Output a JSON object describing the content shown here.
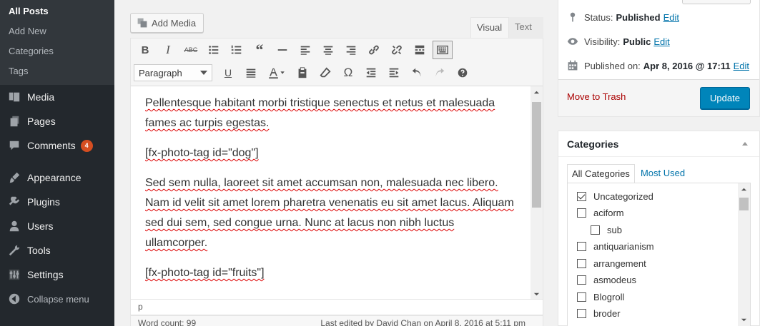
{
  "sidebar": {
    "submenu": [
      "All Posts",
      "Add New",
      "Categories",
      "Tags"
    ],
    "menu": [
      {
        "label": "Media",
        "icon": "media-icon"
      },
      {
        "label": "Pages",
        "icon": "pages-icon"
      },
      {
        "label": "Comments",
        "icon": "comments-icon",
        "badge": "4"
      },
      {
        "label": "Appearance",
        "icon": "appearance-icon"
      },
      {
        "label": "Plugins",
        "icon": "plugins-icon"
      },
      {
        "label": "Users",
        "icon": "users-icon"
      },
      {
        "label": "Tools",
        "icon": "tools-icon"
      },
      {
        "label": "Settings",
        "icon": "settings-icon"
      }
    ],
    "collapse_label": "Collapse menu"
  },
  "editor": {
    "add_media_label": "Add Media",
    "tabs": {
      "visual": "Visual",
      "text": "Text"
    },
    "format_select": "Paragraph",
    "paragraphs": [
      "Pellentesque habitant morbi tristique senectus et netus et malesuada fames ac turpis egestas.",
      "[fx-photo-tag id=\"dog\"]",
      "Sed sem nulla, laoreet sit amet accumsan non, malesuada nec libero. Nam id velit sit amet lorem pharetra venenatis eu sit amet lacus. Aliquam sed dui sem, sed congue urna. Nunc at lacus non nibh luctus ullamcorper.",
      "[fx-photo-tag id=\"fruits\"]"
    ],
    "path": "p",
    "word_count": "Word count: 99",
    "last_edited": "Last edited by David Chan on April 8, 2016 at 5:11 pm"
  },
  "publish": {
    "status_label": "Status:",
    "status_value": "Published",
    "visibility_label": "Visibility:",
    "visibility_value": "Public",
    "published_label": "Published on:",
    "published_value": "Apr 8, 2016 @ 17:11",
    "edit_label": "Edit",
    "trash_label": "Move to Trash",
    "update_label": "Update",
    "accent_color": "#0085ba"
  },
  "categories": {
    "title": "Categories",
    "tabs": {
      "all": "All Categories",
      "most_used": "Most Used"
    },
    "items": [
      {
        "label": "Uncategorized",
        "checked": true,
        "child": false
      },
      {
        "label": "aciform",
        "checked": false,
        "child": false
      },
      {
        "label": "sub",
        "checked": false,
        "child": true
      },
      {
        "label": "antiquarianism",
        "checked": false,
        "child": false
      },
      {
        "label": "arrangement",
        "checked": false,
        "child": false
      },
      {
        "label": "asmodeus",
        "checked": false,
        "child": false
      },
      {
        "label": "Blogroll",
        "checked": false,
        "child": false
      },
      {
        "label": "broder",
        "checked": false,
        "child": false
      }
    ]
  }
}
